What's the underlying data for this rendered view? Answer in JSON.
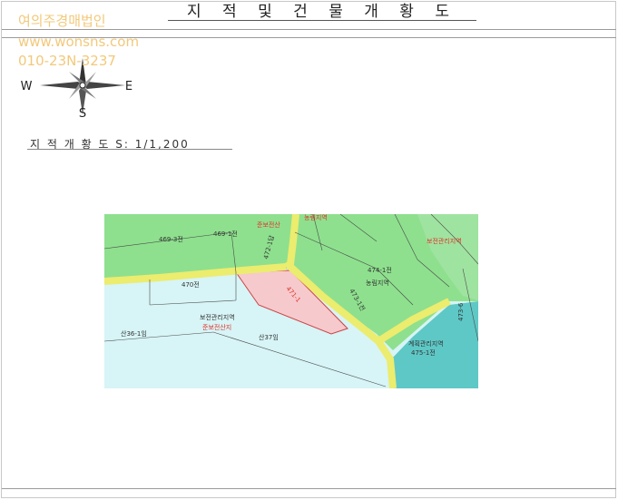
{
  "document": {
    "title": "지 적 및 건 물 개 황 도",
    "scale_label": "지 적 개 황 도 S: 1/1,200"
  },
  "watermark": {
    "company": "여의주경매법인",
    "website": "www.wonsns.com",
    "phone": "010-23N-3237"
  },
  "compass": {
    "north": "N",
    "south": "S",
    "east": "E",
    "west": "W",
    "icon": "compass-rose-icon"
  },
  "map": {
    "labels": {
      "p469_3": "469-3전",
      "p469_1": "469-1전",
      "p472": "472-1답",
      "p474_1": "474-1전",
      "p470": "470전",
      "p471": "471-1",
      "p473": "473-1전",
      "p475_1": "475-1전",
      "p473_6": "473-6",
      "p36_1": "산36-1임",
      "p37": "산37임",
      "zone_conservation": "보전관리지역",
      "zone_forest_red": "준보전산지",
      "zone_agri": "농림지역",
      "zone_plan": "계획관리지역",
      "zone_red_top": "준보전산",
      "top_label": "농림지역",
      "top_right": "보전관리지역",
      "road_left": "도로",
      "road_mid": "도로"
    },
    "colors": {
      "agri_green": "#8ee08e",
      "conservation_blue": "#d7f4f6",
      "plan_teal": "#5ec8c6",
      "road_yellow": "#ecec6e",
      "subject_pink": "#f6c9cd",
      "label_red": "#e0342a"
    }
  }
}
